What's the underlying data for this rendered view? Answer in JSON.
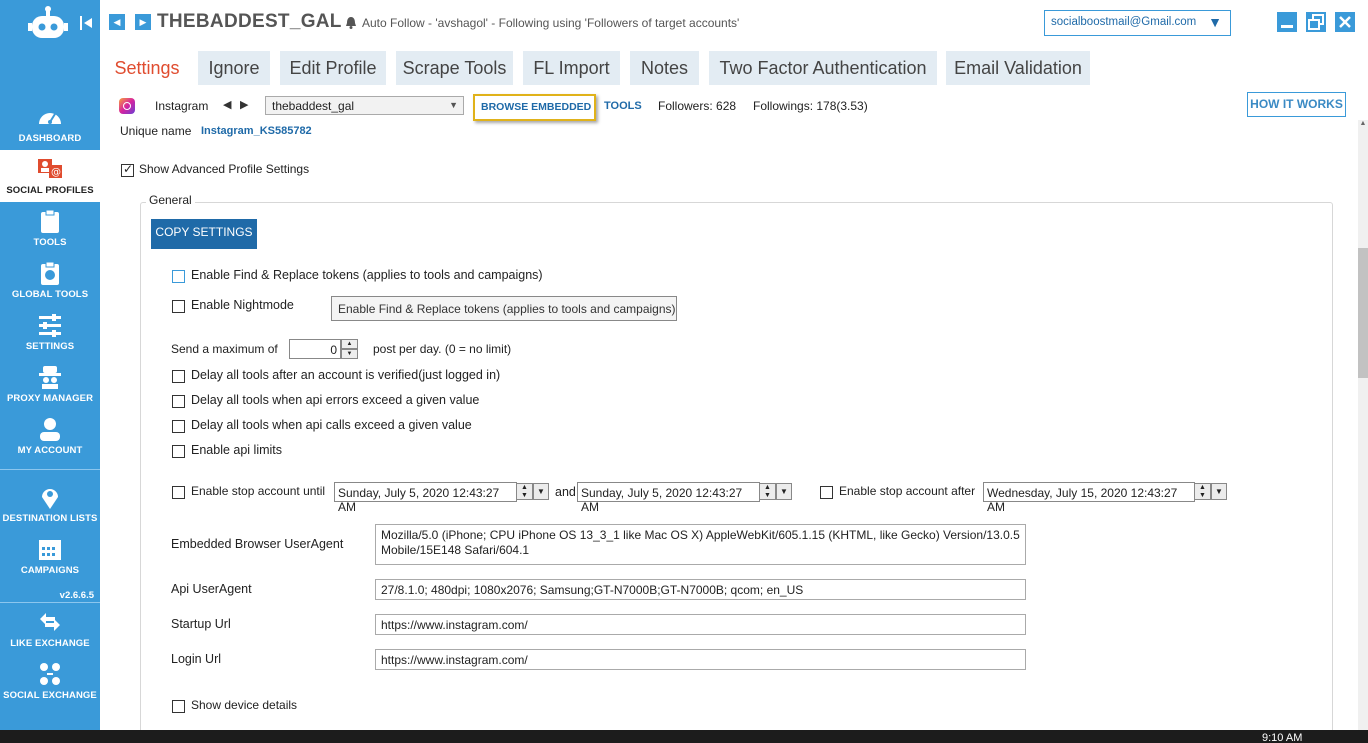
{
  "sidebar": {
    "items": [
      {
        "label": "DASHBOARD",
        "icon": "gauge-icon"
      },
      {
        "label": "SOCIAL PROFILES",
        "icon": "profiles-icon"
      },
      {
        "label": "TOOLS",
        "icon": "clipboard-icon"
      },
      {
        "label": "GLOBAL TOOLS",
        "icon": "globe-clipboard-icon"
      },
      {
        "label": "SETTINGS",
        "icon": "sliders-icon"
      },
      {
        "label": "PROXY MANAGER",
        "icon": "spy-icon"
      },
      {
        "label": "MY ACCOUNT",
        "icon": "user-icon"
      },
      {
        "label": "DESTINATION LISTS",
        "icon": "map-pin-icon"
      },
      {
        "label": "CAMPAIGNS",
        "icon": "calendar-icon"
      },
      {
        "label": "LIKE EXCHANGE",
        "icon": "like-exchange-icon"
      },
      {
        "label": "SOCIAL EXCHANGE",
        "icon": "social-exchange-icon"
      }
    ],
    "version": "v2.6.6.5"
  },
  "header": {
    "title": "THEBADDEST_GAL",
    "status": "Auto Follow - 'avshagol' - Following using 'Followers of target accounts'",
    "email": "socialboostmail@Gmail.com"
  },
  "tabs": [
    {
      "label": "Settings",
      "active": true
    },
    {
      "label": "Ignore"
    },
    {
      "label": "Edit Profile"
    },
    {
      "label": "Scrape Tools"
    },
    {
      "label": "FL Import"
    },
    {
      "label": "Notes"
    },
    {
      "label": "Two Factor Authentication"
    },
    {
      "label": "Email Validation"
    }
  ],
  "account": {
    "platform": "Instagram",
    "selected": "thebaddest_gal",
    "browse_label": "BROWSE EMBEDDED",
    "tools_label": "TOOLS",
    "followers": "Followers: 628",
    "followings": "Followings: 178(3.53)",
    "how_label": "HOW IT WORKS",
    "unique_label": "Unique name",
    "unique_value": "Instagram_KS585782"
  },
  "advanced": {
    "label": "Show Advanced Profile Settings",
    "checked": true
  },
  "general": {
    "title": "General",
    "copy_label": "COPY SETTINGS",
    "find_replace": "Enable Find & Replace tokens (applies to tools and campaigns)",
    "nightmode": "Enable Nightmode",
    "tooltip": "Enable Find & Replace tokens (applies to tools and campaigns)",
    "max_prefix": "Send a maximum of",
    "max_value": "0",
    "max_suffix": "post per day. (0 = no limit)",
    "delay_verified": "Delay all tools after an account is verified(just logged in)",
    "delay_errors": "Delay all tools when api errors exceed a given value",
    "delay_calls": "Delay all tools when api calls exceed a given value",
    "api_limits": "Enable api limits",
    "stop_until": "Enable stop account until",
    "date_from": "Sunday, July 5, 2020 12:43:27 AM",
    "and_label": "and",
    "date_to": "Sunday, July 5, 2020 12:43:27 AM",
    "stop_after": "Enable stop account after",
    "date_after": "Wednesday, July 15, 2020 12:43:27 AM",
    "ua_label": "Embedded Browser UserAgent",
    "ua_value": "Mozilla/5.0 (iPhone; CPU iPhone OS 13_3_1 like Mac OS X) AppleWebKit/605.1.15 (KHTML, like Gecko) Version/13.0.5 Mobile/15E148 Safari/604.1",
    "api_ua_label": "Api UserAgent",
    "api_ua_value": "27/8.1.0; 480dpi; 1080x2076; Samsung;GT-N7000B;GT-N7000B; qcom; en_US",
    "startup_label": "Startup Url",
    "startup_value": "https://www.instagram.com/",
    "login_label": "Login Url",
    "login_value": "https://www.instagram.com/",
    "device_details": "Show device details"
  },
  "taskbar": {
    "clock": "9:10 AM"
  },
  "colors": {
    "sidebar": "#3a9ad9",
    "accent": "#1f6aa8",
    "active_tab": "#e04c2f"
  }
}
